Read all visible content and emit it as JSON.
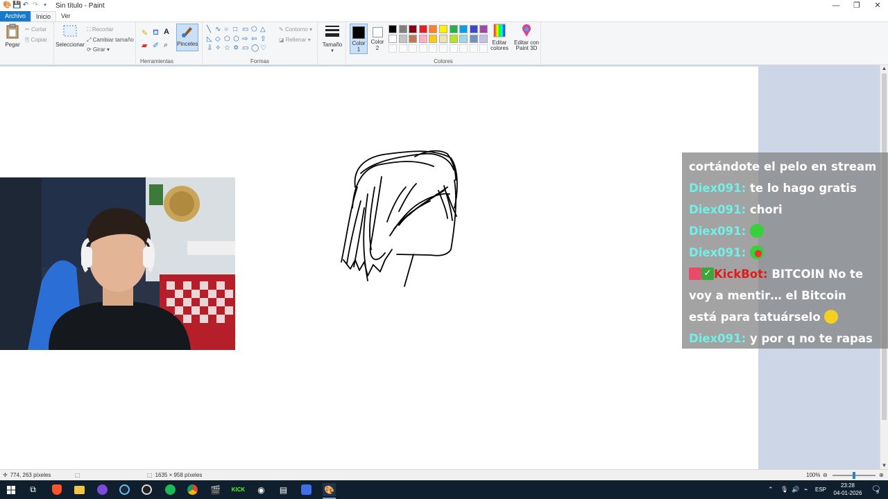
{
  "window": {
    "title": "Sin título - Paint",
    "controls": {
      "minimize": "—",
      "maximize": "❐",
      "close": "✕"
    }
  },
  "menu": {
    "tabs": [
      "Archivo",
      "Inicio",
      "Ver"
    ]
  },
  "ribbon": {
    "portapapeles": {
      "paste": "Pegar",
      "cut": "Cortar",
      "copy": "Copiar"
    },
    "imagen": {
      "select": "Seleccionar",
      "crop": "Recortar",
      "resize": "Cambiar tamaño",
      "rotate": "Girar"
    },
    "herramientas": {
      "label": "Herramientas",
      "brushes": "Pinceles"
    },
    "formas": {
      "label": "Formas",
      "outline": "Contorno",
      "fill": "Rellenar"
    },
    "size": {
      "label": "Tamaño"
    },
    "colores": {
      "label": "Colores",
      "color1": "Color 1",
      "color2": "Color 2",
      "edit": "Editar colores",
      "paint3d": "Editar con Paint 3D",
      "palette_row1": [
        "#000000",
        "#7f7f7f",
        "#880015",
        "#ed1c24",
        "#ff7f27",
        "#fff200",
        "#22b14c",
        "#00a2e8",
        "#3f48cc",
        "#a349a4"
      ],
      "palette_row2": [
        "#ffffff",
        "#c3c3c3",
        "#b97a57",
        "#ffaec9",
        "#ffc90e",
        "#efe4b0",
        "#b5e61d",
        "#99d9ea",
        "#7092be",
        "#c8bfe7"
      ]
    }
  },
  "chat": {
    "lines": [
      {
        "user": "",
        "text": "cortándote el pelo en stream"
      },
      {
        "user": "Diex091",
        "text": "te lo hago gratis"
      },
      {
        "user": "Diex091",
        "text": "chori"
      },
      {
        "user": "Diex091",
        "text": "",
        "emote": "green-emote"
      },
      {
        "user": "Diex091",
        "text": "",
        "emote": "green-red-emote"
      },
      {
        "user": "KickBot",
        "text": "BITCOIN No te",
        "bot": true
      },
      {
        "user": "",
        "text": "voy a mentir… el Bitcoin"
      },
      {
        "user": "",
        "text": "está para tatuárselo",
        "emote": "yellow-emote"
      },
      {
        "user": "Diex091",
        "text": "y por q no te rapas"
      }
    ]
  },
  "status": {
    "cursor": "774, 263 píxeles",
    "size": "1635 × 958 píxeles",
    "zoom": "100%",
    "zoom_fraction": 0.5
  },
  "taskbar": {
    "lang": "ESP",
    "time": "23:28",
    "date": "04-01-2026",
    "notifications": "9"
  },
  "colors": {
    "accent": "#1979ca",
    "chat_user": "#70f0e6",
    "kickbot": "#e11a1a"
  }
}
